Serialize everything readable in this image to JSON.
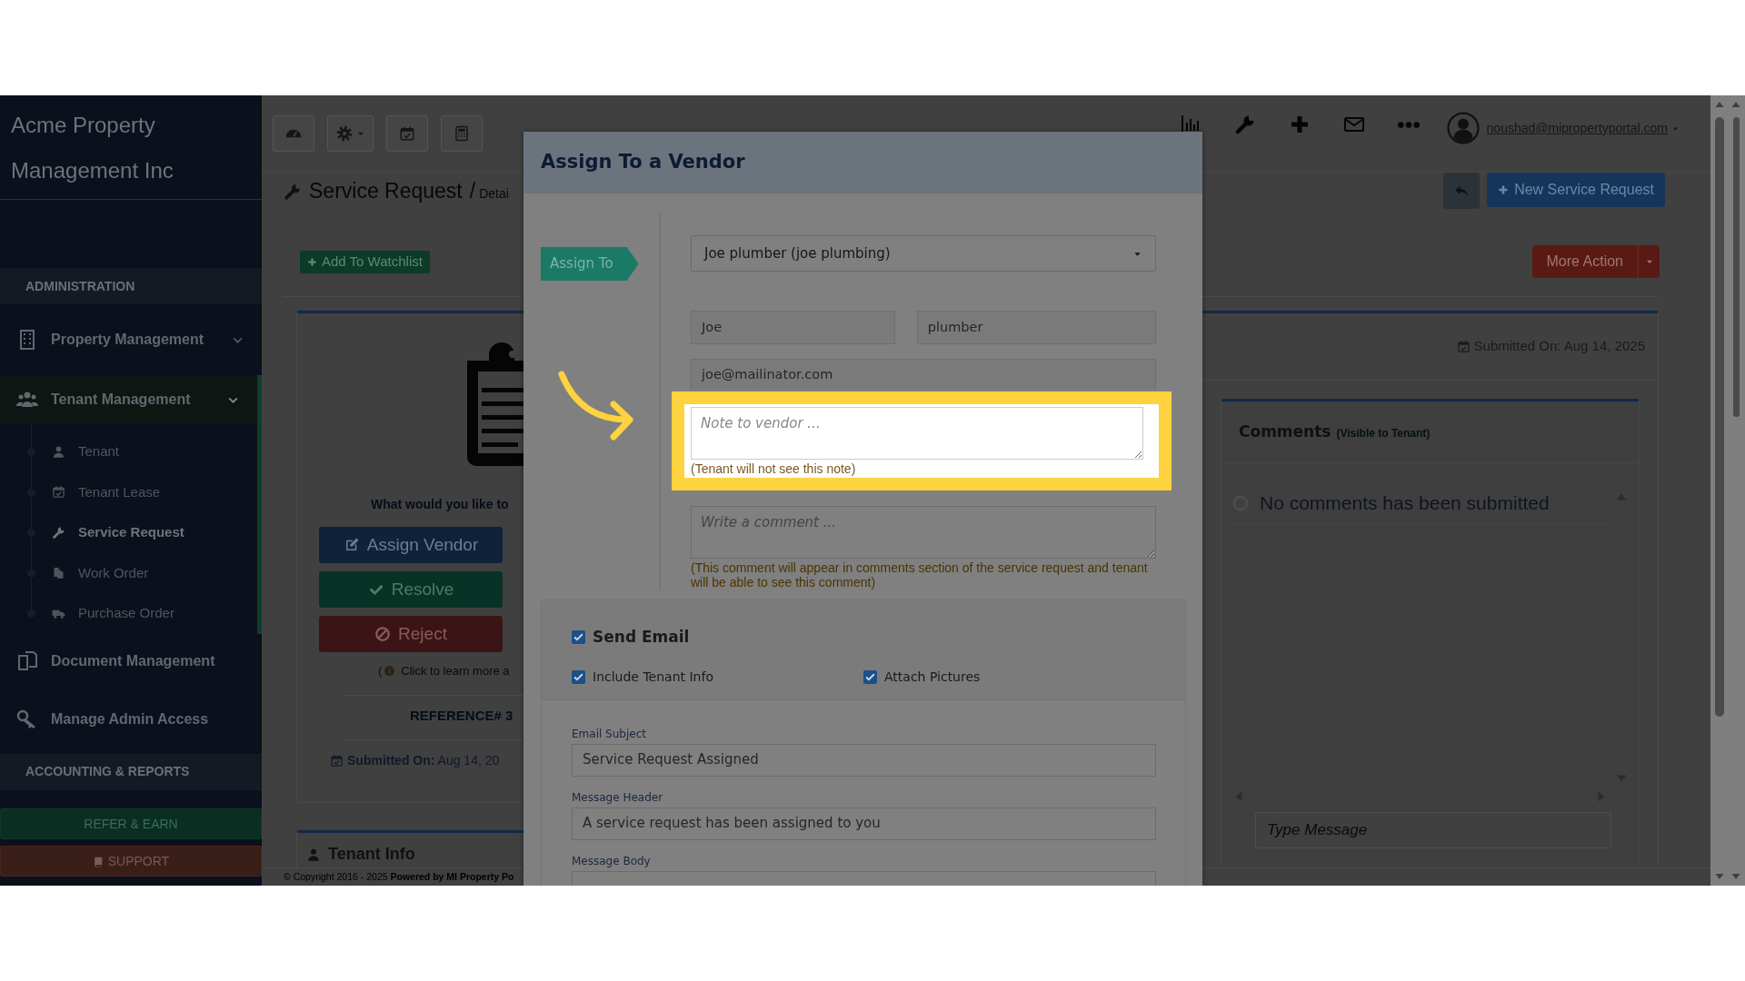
{
  "sidebar": {
    "brand": "Acme Property Management Inc",
    "items": [
      {
        "kind": "section",
        "label": "ADMINISTRATION"
      },
      {
        "kind": "menu",
        "label": "Property Management",
        "expanded": false,
        "selected": false
      },
      {
        "kind": "menu",
        "label": "Tenant Management",
        "expanded": true,
        "selected": true,
        "children": [
          {
            "label": "Tenant",
            "selected": false
          },
          {
            "label": "Tenant Lease",
            "selected": false
          },
          {
            "label": "Service Request",
            "selected": true
          },
          {
            "label": "Work Order",
            "selected": false
          },
          {
            "label": "Purchase Order",
            "selected": false
          }
        ]
      },
      {
        "kind": "link",
        "label": "Document Management"
      },
      {
        "kind": "link",
        "label": "Manage Admin Access"
      },
      {
        "kind": "section",
        "label": "ACCOUNTING & REPORTS"
      }
    ],
    "buttons": [
      {
        "kind": "refer",
        "label": "REFER & EARN"
      },
      {
        "kind": "support",
        "label": "SUPPORT"
      }
    ]
  },
  "topbar": {
    "user": "noushad@mipropertyportal.com"
  },
  "page": {
    "title": "Service Request",
    "breadcrumb_separator": "/",
    "breadcrumb": "Detai",
    "new_button": "New Service Request",
    "watchlist_button": "Add To Watchlist",
    "more_button": "More Action",
    "action_prompt": "What would you like to",
    "actions": [
      {
        "kind": "assign",
        "label": "Assign Vendor"
      },
      {
        "kind": "resolve",
        "label": "Resolve"
      },
      {
        "kind": "reject",
        "label": "Reject"
      }
    ],
    "learn_more_paren": "(",
    "learn_more": "Click to learn more a",
    "reference": "REFERENCE# 3",
    "submitted": "**Submitted On:** Aug 14, 20",
    "tenant_info": "Tenant Info",
    "submitted_right": "Submitted On: Aug 14, 2025",
    "footer": "© Copyright 2016 - 2025 **Powered by MI Property Po**"
  },
  "comments": {
    "title": "Comments",
    "note": "(Visible to Tenant)",
    "empty": "No comments has been submitted",
    "placeholder": "Type Message"
  },
  "modal": {
    "title": "Assign To a Vendor",
    "ribbon": "Assign To",
    "vendor": "Joe plumber (joe plumbing)",
    "first_name": "Joe",
    "last_name": "plumber",
    "email": "joe@mailinator.com",
    "note": {
      "placeholder": "Note to vendor ...",
      "hint": "(Tenant will not see this note)",
      "highlighted": true
    },
    "comment": {
      "placeholder": "Write a comment ...",
      "hint": "(This comment will appear in comments section of the service request and tenant will be able to see this comment)"
    },
    "send_email": {
      "label": "Send Email",
      "checked": true
    },
    "options": [
      {
        "label": "Include Tenant Info",
        "checked": true
      },
      {
        "label": "Attach Pictures",
        "checked": true
      }
    ],
    "fields": [
      {
        "label": "Email Subject",
        "value": "Service Request Assigned"
      },
      {
        "label": "Message Header",
        "value": "A service request has been assigned to you"
      },
      {
        "label": "Message Body"
      }
    ]
  }
}
